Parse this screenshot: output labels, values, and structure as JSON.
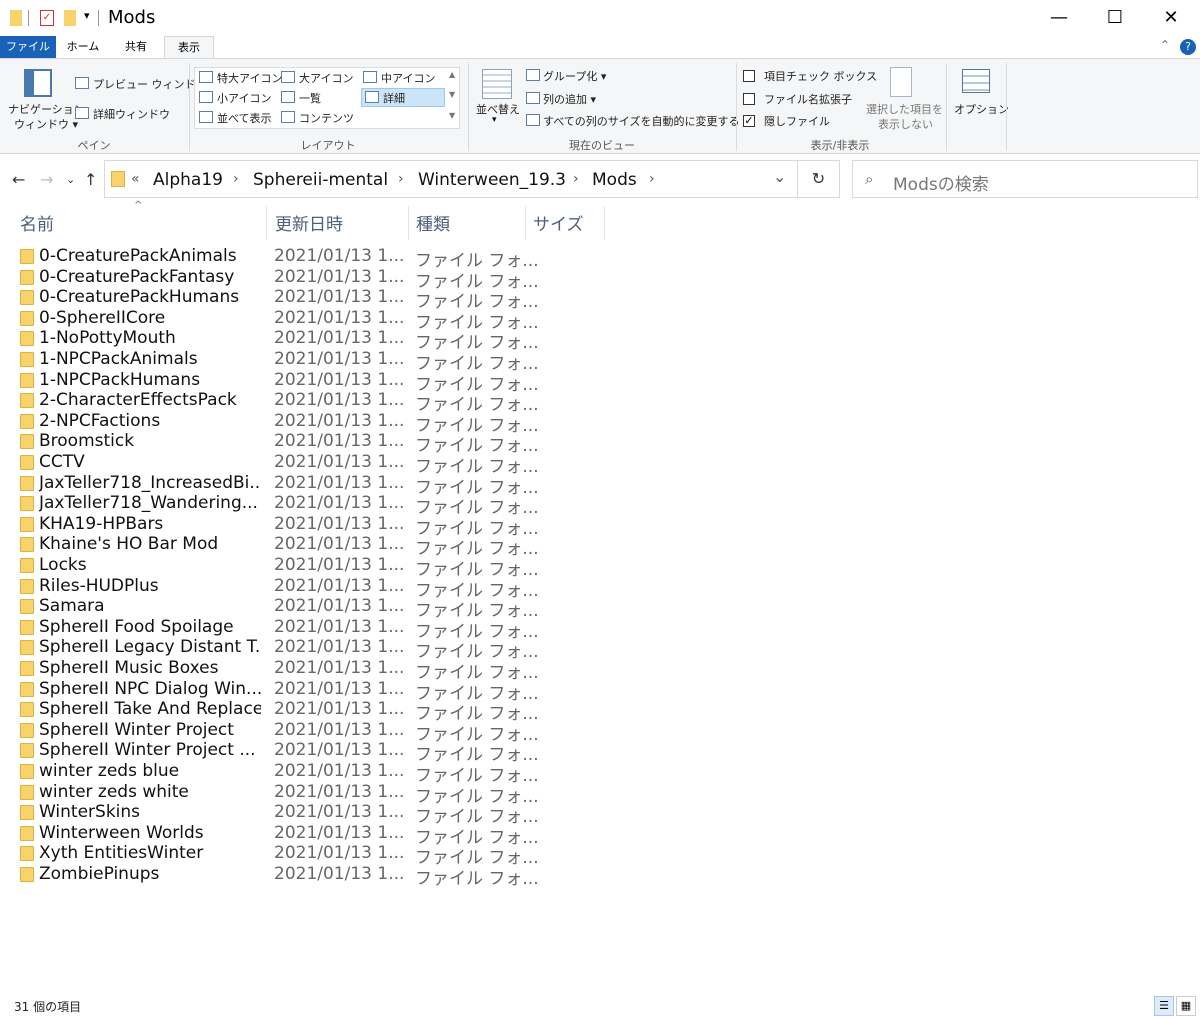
{
  "window": {
    "title": "Mods",
    "minimize": "—",
    "maximize": "☐",
    "close": "✕"
  },
  "tabs": [
    "ファイル",
    "ホーム",
    "共有",
    "表示"
  ],
  "ribbon": {
    "pane": {
      "nav_line1": "ナビゲーション",
      "nav_line2": "ウィンドウ ▾",
      "preview": "プレビュー ウィンドウ",
      "details": "詳細ウィンドウ",
      "group": "ペイン"
    },
    "layout": {
      "xl_icons": "特大アイコン",
      "large_icons": "大アイコン",
      "medium_icons": "中アイコン",
      "small_icons": "小アイコン",
      "list": "一覧",
      "details": "詳細",
      "tiles": "並べて表示",
      "content": "コンテンツ",
      "group": "レイアウト"
    },
    "view": {
      "sort_line1": "並べ替え",
      "group_by": "グループ化 ▾",
      "add_columns": "列の追加 ▾",
      "size_all": "すべての列のサイズを自動的に変更する",
      "group": "現在のビュー"
    },
    "showhide": {
      "item_checkbox": "項目チェック ボックス",
      "extensions": "ファイル名拡張子",
      "hidden": "隠しファイル",
      "hide_selected_line1": "選択した項目を",
      "hide_selected_line2": "表示しない",
      "group": "表示/非表示"
    },
    "options": "オプション"
  },
  "address": {
    "overflow": "«",
    "crumbs": [
      "Alpha19",
      "Sphereii-mental",
      "Winterween_19.3",
      "Mods"
    ],
    "separator": "›",
    "dropdown": "⌄",
    "refresh": "↻"
  },
  "search": {
    "icon": "⌕",
    "placeholder": "Modsの検索"
  },
  "columns": {
    "name": "名前",
    "date": "更新日時",
    "type": "種類",
    "size": "サイズ",
    "sort_indicator": "^"
  },
  "files": [
    {
      "name": "0-CreaturePackAnimals",
      "date": "2021/01/13 1...",
      "type": "ファイル フォ..."
    },
    {
      "name": "0-CreaturePackFantasy",
      "date": "2021/01/13 1...",
      "type": "ファイル フォ..."
    },
    {
      "name": "0-CreaturePackHumans",
      "date": "2021/01/13 1...",
      "type": "ファイル フォ..."
    },
    {
      "name": "0-SphereIICore",
      "date": "2021/01/13 1...",
      "type": "ファイル フォ..."
    },
    {
      "name": "1-NoPottyMouth",
      "date": "2021/01/13 1...",
      "type": "ファイル フォ..."
    },
    {
      "name": "1-NPCPackAnimals",
      "date": "2021/01/13 1...",
      "type": "ファイル フォ..."
    },
    {
      "name": "1-NPCPackHumans",
      "date": "2021/01/13 1...",
      "type": "ファイル フォ..."
    },
    {
      "name": "2-CharacterEffectsPack",
      "date": "2021/01/13 1...",
      "type": "ファイル フォ..."
    },
    {
      "name": "2-NPCFactions",
      "date": "2021/01/13 1...",
      "type": "ファイル フォ..."
    },
    {
      "name": "Broomstick",
      "date": "2021/01/13 1...",
      "type": "ファイル フォ..."
    },
    {
      "name": "CCTV",
      "date": "2021/01/13 1...",
      "type": "ファイル フォ..."
    },
    {
      "name": "JaxTeller718_IncreasedBi...",
      "date": "2021/01/13 1...",
      "type": "ファイル フォ..."
    },
    {
      "name": "JaxTeller718_Wandering...",
      "date": "2021/01/13 1...",
      "type": "ファイル フォ..."
    },
    {
      "name": "KHA19-HPBars",
      "date": "2021/01/13 1...",
      "type": "ファイル フォ..."
    },
    {
      "name": "Khaine's HO Bar Mod",
      "date": "2021/01/13 1...",
      "type": "ファイル フォ..."
    },
    {
      "name": "Locks",
      "date": "2021/01/13 1...",
      "type": "ファイル フォ..."
    },
    {
      "name": "Riles-HUDPlus",
      "date": "2021/01/13 1...",
      "type": "ファイル フォ..."
    },
    {
      "name": "Samara",
      "date": "2021/01/13 1...",
      "type": "ファイル フォ..."
    },
    {
      "name": "SphereII Food Spoilage",
      "date": "2021/01/13 1...",
      "type": "ファイル フォ..."
    },
    {
      "name": "SphereII Legacy Distant T...",
      "date": "2021/01/13 1...",
      "type": "ファイル フォ..."
    },
    {
      "name": "SphereII Music Boxes",
      "date": "2021/01/13 1...",
      "type": "ファイル フォ..."
    },
    {
      "name": "SphereII NPC Dialog Win...",
      "date": "2021/01/13 1...",
      "type": "ファイル フォ..."
    },
    {
      "name": "SphereII Take And Replace",
      "date": "2021/01/13 1...",
      "type": "ファイル フォ..."
    },
    {
      "name": "SphereII Winter Project",
      "date": "2021/01/13 1...",
      "type": "ファイル フォ..."
    },
    {
      "name": "SphereII Winter Project ...",
      "date": "2021/01/13 1...",
      "type": "ファイル フォ..."
    },
    {
      "name": "winter zeds blue",
      "date": "2021/01/13 1...",
      "type": "ファイル フォ..."
    },
    {
      "name": "winter zeds white",
      "date": "2021/01/13 1...",
      "type": "ファイル フォ..."
    },
    {
      "name": "WinterSkins",
      "date": "2021/01/13 1...",
      "type": "ファイル フォ..."
    },
    {
      "name": "Winterween Worlds",
      "date": "2021/01/13 1...",
      "type": "ファイル フォ..."
    },
    {
      "name": "Xyth EntitiesWinter",
      "date": "2021/01/13 1...",
      "type": "ファイル フォ..."
    },
    {
      "name": "ZombiePinups",
      "date": "2021/01/13 1...",
      "type": "ファイル フォ..."
    }
  ],
  "status": {
    "count": "31 個の項目"
  },
  "colors": {
    "accent": "#1a62b7",
    "folder": "#f8d36b"
  }
}
